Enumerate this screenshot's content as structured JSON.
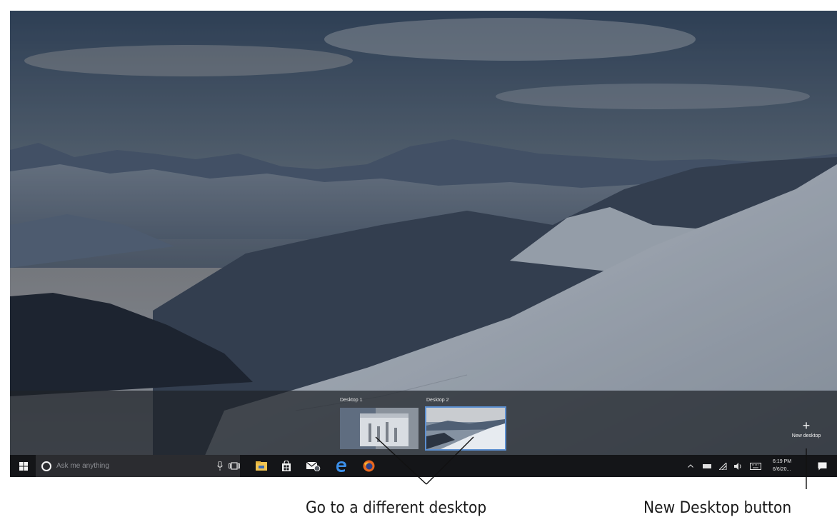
{
  "timeline": {
    "desktops": [
      {
        "label": "Desktop 1",
        "active": false
      },
      {
        "label": "Desktop 2",
        "active": true
      }
    ],
    "new_desktop_label": "New desktop"
  },
  "taskbar": {
    "search_placeholder": "Ask me anything",
    "pinned_icons": [
      "task-view-icon",
      "file-explorer-icon",
      "store-icon",
      "mail-icon",
      "edge-icon",
      "firefox-icon"
    ],
    "tray": {
      "time": "6:19 PM",
      "date": "6/6/20..."
    }
  },
  "captions": {
    "go_to_desktop": "Go to a different desktop",
    "new_desktop_button": "New Desktop button"
  },
  "colors": {
    "taskbar": "#141518",
    "search_box": "#2b2c30",
    "active_thumb_border": "#5c8fd0",
    "edge_blue": "#3b8ee8",
    "firefox_orange": "#e8681f"
  }
}
